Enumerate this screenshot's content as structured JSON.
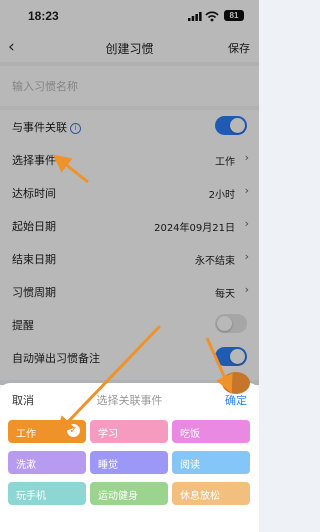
{
  "status": {
    "time": "18:23",
    "battery": "81"
  },
  "nav": {
    "title": "创建习惯",
    "save": "保存"
  },
  "name_input": {
    "placeholder": "输入习惯名称"
  },
  "rows": {
    "link_event": "与事件关联",
    "select_event": {
      "label": "选择事件",
      "value": "工作"
    },
    "target_time": {
      "label": "达标时间",
      "value": "2小时"
    },
    "start_date": {
      "label": "起始日期",
      "value": "2024年09月21日"
    },
    "end_date": {
      "label": "结束日期",
      "value": "永不结束"
    },
    "cycle": {
      "label": "习惯周期",
      "value": "每天"
    },
    "reminder": "提醒",
    "auto_popup": "自动弹出习惯备注"
  },
  "toggles": {
    "link_event": true,
    "reminder": false,
    "auto_popup": true
  },
  "sheet": {
    "cancel": "取消",
    "title": "选择关联事件",
    "confirm": "确定",
    "events": [
      "工作",
      "学习",
      "吃饭",
      "洗漱",
      "睡觉",
      "阅读",
      "玩手机",
      "运动健身",
      "休息放松"
    ],
    "selected": "工作"
  },
  "colors": {
    "accent": "#2d7ff9",
    "annotation": "#f0922a"
  }
}
